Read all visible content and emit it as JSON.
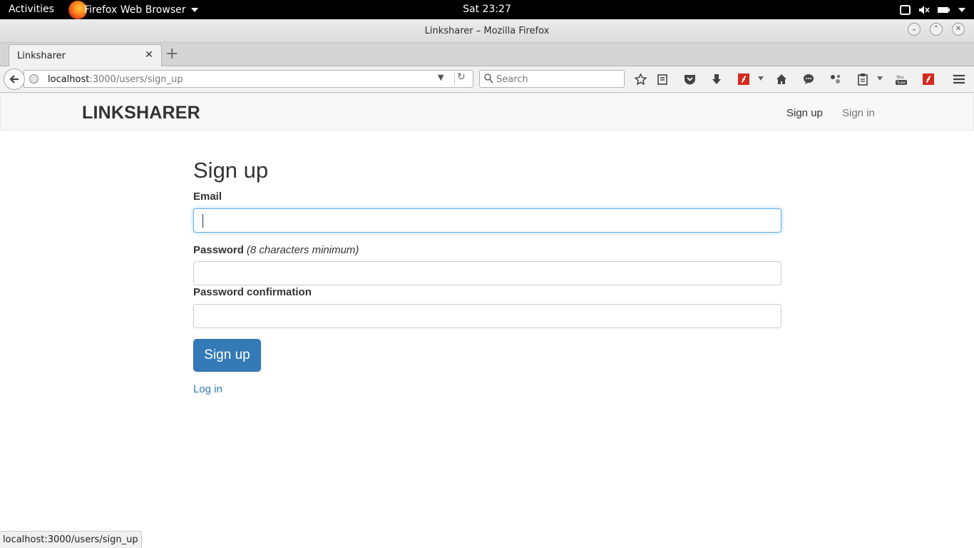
{
  "topbar": {
    "activities": "Activities",
    "app_name": "Firefox Web Browser",
    "clock": "Sat 23:27"
  },
  "window": {
    "title": "Linksharer – Mozilla Firefox"
  },
  "tabs": [
    {
      "label": "Linksharer"
    }
  ],
  "urlbar": {
    "host": "localhost",
    "path": ":3000/users/sign_up"
  },
  "search": {
    "placeholder": "Search"
  },
  "site": {
    "brand": "LINKSHARER",
    "nav": {
      "sign_up": "Sign up",
      "sign_in": "Sign in"
    }
  },
  "form": {
    "heading": "Sign up",
    "email_label": "Email",
    "email_value": "",
    "password_label": "Password",
    "password_hint": "(8 characters minimum)",
    "password_value": "",
    "confirm_label": "Password confirmation",
    "confirm_value": "",
    "submit_label": "Sign up",
    "login_link": "Log in"
  },
  "statusbar": {
    "text": "localhost:3000/users/sign_up"
  },
  "colors": {
    "primary": "#337ab7",
    "focus_border": "#66afe9",
    "flash_red": "#d42a1f"
  }
}
